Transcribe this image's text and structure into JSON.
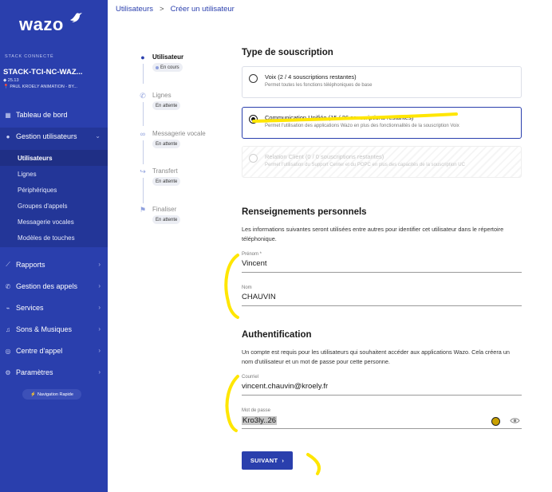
{
  "app": {
    "logo_text": "wazo"
  },
  "stack": {
    "label": "STACK CONNECTÉ",
    "name": "STACK-TCI-NC-WAZ...",
    "version": "25.13",
    "client": "PAUL KROELY ANIMATION - BY..."
  },
  "sidebar": {
    "items": [
      {
        "label": "Tableau de bord",
        "icon": "grid-icon"
      },
      {
        "label": "Gestion utilisateurs",
        "icon": "users-icon",
        "expanded": true
      },
      {
        "label": "Rapports",
        "icon": "chart-icon"
      },
      {
        "label": "Gestion des appels",
        "icon": "phone-icon"
      },
      {
        "label": "Services",
        "icon": "services-icon"
      },
      {
        "label": "Sons & Musiques",
        "icon": "music-icon"
      },
      {
        "label": "Centre d'appel",
        "icon": "headset-icon"
      },
      {
        "label": "Paramètres",
        "icon": "gear-icon"
      }
    ],
    "subitems": [
      "Utilisateurs",
      "Lignes",
      "Périphériques",
      "Groupes d'appels",
      "Messagerie vocales",
      "Modèles de touches"
    ],
    "quick_nav": "Navigation Rapide"
  },
  "breadcrumb": {
    "parent": "Utilisateurs",
    "separator": ">",
    "current": "Créer un utilisateur"
  },
  "steps": [
    {
      "label": "Utilisateur",
      "status": "En cours",
      "icon": "user-icon"
    },
    {
      "label": "Lignes",
      "status": "En attente",
      "icon": "phone-icon"
    },
    {
      "label": "Messagerie vocale",
      "status": "En attente",
      "icon": "voicemail-icon"
    },
    {
      "label": "Transfert",
      "status": "En attente",
      "icon": "forward-icon"
    },
    {
      "label": "Finaliser",
      "status": "En attente",
      "icon": "flag-icon"
    }
  ],
  "subscription": {
    "title": "Type de souscription",
    "options": [
      {
        "title": "Voix (2 / 4 souscriptions restantes)",
        "desc": "Permet toutes les fonctions téléphoniques de base",
        "state": "unselected"
      },
      {
        "title": "Communication Unifiée (15 / 26 souscriptions restantes)",
        "desc": "Permet l'utilisation des applications Wazo en plus des fonctionnalités de la souscription Voix",
        "state": "selected"
      },
      {
        "title": "Relation Client (0 / 0 souscriptions restantes)",
        "desc": "Permet l'utilisation du Support Center et du POPC en plus des capacités de la souscription UC",
        "state": "disabled"
      }
    ]
  },
  "personal": {
    "title": "Renseignements personnels",
    "text": "Les informations suivantes seront utilisées entre autres pour identifier cet utilisateur dans le répertoire téléphonique.",
    "firstname_label": "Prénom *",
    "firstname_value": "Vincent",
    "lastname_label": "Nom",
    "lastname_value": "CHAUVIN"
  },
  "auth": {
    "title": "Authentification",
    "text": "Un compte est requis pour les utilisateurs qui souhaitent accéder aux applications Wazo. Cela créera un nom d'utilisateur et un mot de passe pour cette personne.",
    "email_label": "Courriel",
    "email_value": "vincent.chauvin@kroely.fr",
    "password_label": "Mot de passe",
    "password_value": "Kro3ly..26"
  },
  "actions": {
    "next_label": "SUIVANT"
  },
  "colors": {
    "sidebar": "#2a3fad",
    "primary": "#2a3fad",
    "highlight": "#ffe600"
  }
}
